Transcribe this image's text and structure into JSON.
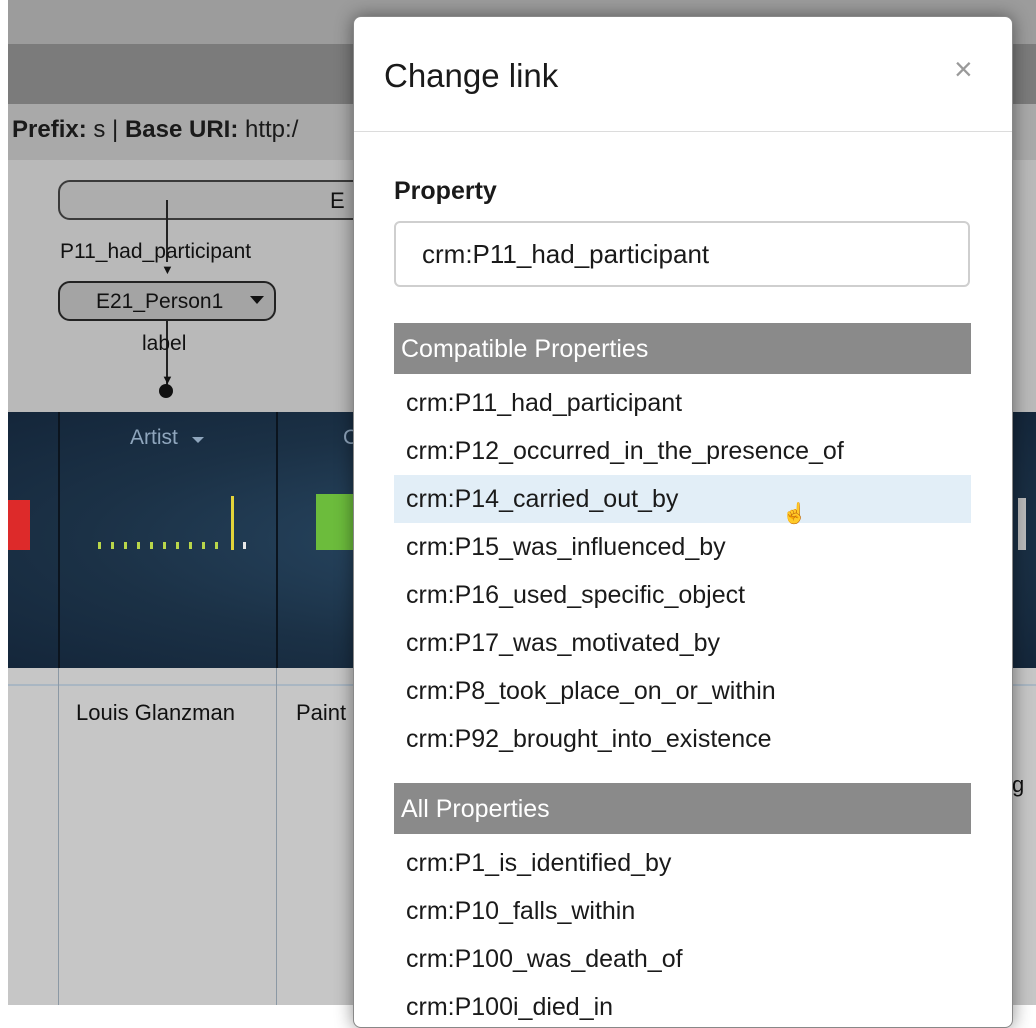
{
  "background": {
    "prefix_label": "Prefix:",
    "prefix_value": " s | ",
    "base_uri_label": "Base URI:",
    "base_uri_value": " http:/",
    "class_node_text": "E",
    "link_property": "P11_had_participant",
    "person_node": "E21_Person1",
    "label_text": "label",
    "column_header": "Artist",
    "column_header_partial": "C",
    "cell_artist": "Louis Glanzman",
    "cell_partial": "Paint",
    "cell_right_partial": "g"
  },
  "modal": {
    "title": "Change link",
    "close_glyph": "×",
    "property_label": "Property",
    "property_value": "crm:P11_had_participant",
    "compatible_header": "Compatible Properties",
    "compatible": [
      "crm:P11_had_participant",
      "crm:P12_occurred_in_the_presence_of",
      "crm:P14_carried_out_by",
      "crm:P15_was_influenced_by",
      "crm:P16_used_specific_object",
      "crm:P17_was_motivated_by",
      "crm:P8_took_place_on_or_within",
      "crm:P92_brought_into_existence"
    ],
    "highlighted_item": "crm:P14_carried_out_by",
    "all_header": "All Properties",
    "all": [
      "crm:P1_is_identified_by",
      "crm:P10_falls_within",
      "crm:P100_was_death_of",
      "crm:P100i_died_in"
    ]
  },
  "colors": {
    "modal_section_header": "#8a8a8a",
    "highlight": "#e2eef7",
    "band": "#1b3146"
  }
}
